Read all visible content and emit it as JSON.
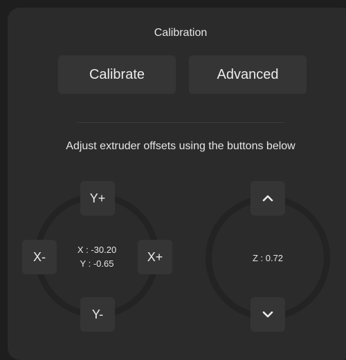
{
  "window": {
    "title": "Calibration"
  },
  "actions": {
    "calibrate_label": "Calibrate",
    "advanced_label": "Advanced"
  },
  "instructions": "Adjust extruder offsets using the buttons below",
  "xy_pad": {
    "y_plus": "Y+",
    "y_minus": "Y-",
    "x_minus": "X-",
    "x_plus": "X+",
    "x_readout": "X : -30.20",
    "y_readout": "Y : -0.65"
  },
  "z_pad": {
    "up_icon": "chevron-up-icon",
    "down_icon": "chevron-down-icon",
    "z_readout": "Z : 0.72"
  },
  "colors": {
    "background": "#1e1e1e",
    "panel": "#2b2b2b",
    "button": "#353535",
    "text": "#e6e6e6"
  }
}
